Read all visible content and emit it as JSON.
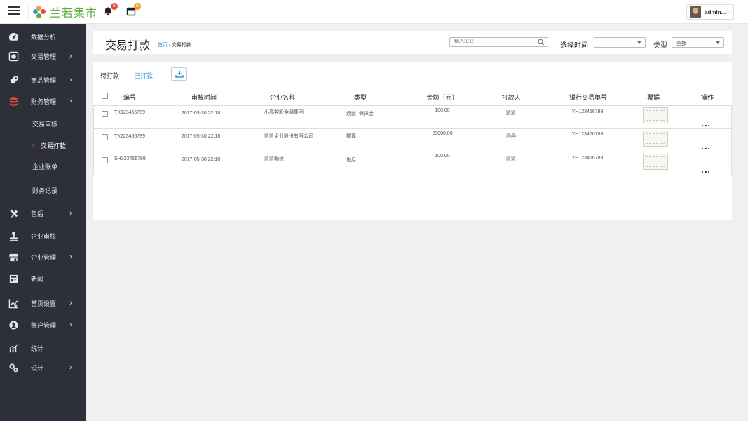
{
  "brand": {
    "name": "兰若集市",
    "accent": "#5cae3e"
  },
  "topbar": {
    "notifications": {
      "icon": "bell-icon",
      "count": "6",
      "color": "#e64a3b"
    },
    "messages": {
      "icon": "calendar-icon",
      "count": "6",
      "color": "#f0a020"
    },
    "user": {
      "name": "admin..."
    }
  },
  "sidebar": {
    "items": [
      {
        "label": "数据分析",
        "icon": "dashboard-icon"
      },
      {
        "label": "交易管理",
        "icon": "trade-icon",
        "arrow": "›"
      },
      {
        "label": "商品管理",
        "icon": "tag-icon",
        "arrow": "›"
      },
      {
        "label": "财务管理",
        "icon": "database-icon",
        "arrow": "›"
      },
      {
        "label": "售后",
        "icon": "tools-icon",
        "arrow": "›"
      },
      {
        "label": "企业审核",
        "icon": "stamp-icon"
      },
      {
        "label": "企业管理",
        "icon": "store-icon",
        "arrow": "›"
      },
      {
        "label": "新闻",
        "icon": "news-icon"
      },
      {
        "label": "首页设置",
        "icon": "chart-settings-icon",
        "arrow": "›"
      },
      {
        "label": "账户管理",
        "icon": "account-icon",
        "arrow": "›"
      },
      {
        "label": "统计",
        "icon": "stats-icon"
      },
      {
        "label": "设计",
        "icon": "design-icon",
        "arrow": "›"
      }
    ],
    "sub_items": [
      {
        "label": "交易审核"
      },
      {
        "label": "交易打款",
        "active": true,
        "marker": "»"
      },
      {
        "label": "企业账单"
      },
      {
        "label": "财务记录"
      }
    ]
  },
  "header": {
    "title": "交易打款",
    "breadcrumb_home": "首页",
    "breadcrumb_sep": " / ",
    "breadcrumb_current": "交易打款",
    "search_placeholder": "输入企业",
    "time_label": "选择时间",
    "time_value": "",
    "type_label": "类型",
    "type_value": "全部"
  },
  "tabs": {
    "pending": "待打款",
    "done": "已打款",
    "active_color": "#2d9be0"
  },
  "table": {
    "headers": [
      "编号",
      "审核时间",
      "企业名称",
      "类型",
      "金额（元）",
      "打款人",
      "银行交易单号",
      "票据",
      "操作"
    ],
    "rows": [
      {
        "id": "TX123456789",
        "time": "2017-05-30 22:18",
        "company": "小高控股金融集团",
        "type": "退款_保障金",
        "amount": "100.00",
        "payer": "凯凯",
        "bank_no": "YH123456789"
      },
      {
        "id": "TX223456789",
        "time": "2017-05-30 22:18",
        "company": "凯凯企业股份有限公司",
        "type": "提现",
        "amount": "20000.00",
        "payer": "高高",
        "bank_no": "YH123456789"
      },
      {
        "id": "SH323456789",
        "time": "2017-05-30 22:18",
        "company": "凯凯物流",
        "type": "售后",
        "amount": "100.00",
        "payer": "凯凯",
        "bank_no": "YH123456789"
      }
    ]
  }
}
